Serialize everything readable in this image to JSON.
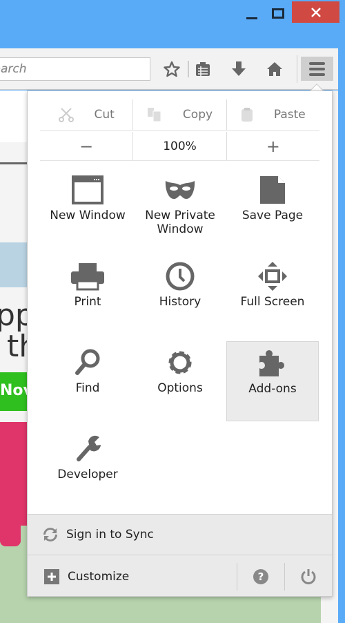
{
  "window": {
    "controls": {
      "minimize": "minimize-icon",
      "maximize": "maximize-icon",
      "close": "close-icon"
    },
    "close_color": "#d04a43",
    "frame_color": "#5aabf7"
  },
  "toolbar": {
    "search_placeholder": "Search",
    "search_visible_text": "arch",
    "icons": [
      "star-icon",
      "bookmarks-icon",
      "download-icon",
      "home-icon",
      "hamburger-menu-icon"
    ]
  },
  "page_behind": {
    "text_line1": "pp",
    "text_line2": "th",
    "button": "Nov"
  },
  "menu": {
    "edit": {
      "cut": "Cut",
      "copy": "Copy",
      "paste": "Paste"
    },
    "zoom": {
      "minus": "−",
      "level": "100%",
      "plus": "+"
    },
    "items": [
      {
        "label": "New Window",
        "icon": "new-window-icon"
      },
      {
        "label": "New Private Window",
        "icon": "private-mask-icon"
      },
      {
        "label": "Save Page",
        "icon": "save-page-icon"
      },
      {
        "label": "Print",
        "icon": "printer-icon"
      },
      {
        "label": "History",
        "icon": "clock-icon"
      },
      {
        "label": "Full Screen",
        "icon": "fullscreen-icon"
      },
      {
        "label": "Find",
        "icon": "magnifier-icon"
      },
      {
        "label": "Options",
        "icon": "gear-icon"
      },
      {
        "label": "Add-ons",
        "icon": "puzzle-icon",
        "highlighted": true
      },
      {
        "label": "Developer",
        "icon": "wrench-icon"
      }
    ],
    "sync": "Sign in to Sync",
    "customize": "Customize",
    "footer_icons": [
      "help-icon",
      "power-icon"
    ]
  }
}
